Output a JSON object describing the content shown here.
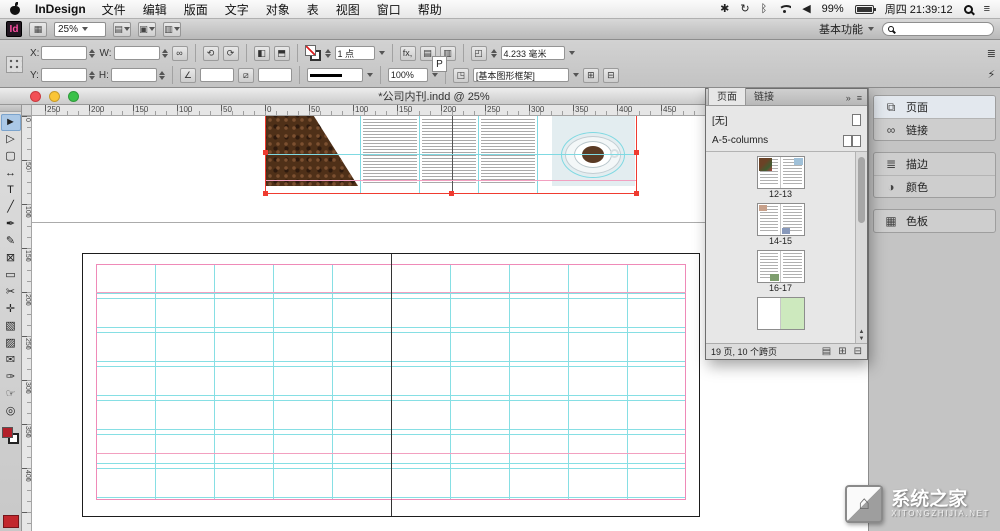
{
  "menu_bar": {
    "app_name": "InDesign",
    "items": [
      "文件",
      "编辑",
      "版面",
      "文字",
      "对象",
      "表",
      "视图",
      "窗口",
      "帮助"
    ],
    "battery": "99%",
    "clock": "周四 21:39:12"
  },
  "app_bar": {
    "logo": "Id",
    "zoom_value": "25%",
    "workspace_label": "基本功能"
  },
  "control_panel": {
    "x_label": "X:",
    "y_label": "Y:",
    "w_label": "W:",
    "h_label": "H:",
    "x_value": "",
    "y_value": "",
    "w_value": "",
    "h_value": "",
    "stroke_weight": "1 点",
    "opacity": "100%",
    "corner_radius": "4.233 毫米",
    "object_style": "[基本图形框架]",
    "p_label": "P",
    "fx_label": "fx,"
  },
  "document": {
    "title": "*公司内刊.indd @ 25%",
    "h_ruler": [
      "250",
      "200",
      "150",
      "100",
      "50",
      "0",
      "50",
      "100",
      "150",
      "200",
      "250",
      "300",
      "350",
      "400",
      "450"
    ],
    "v_ruler": [
      "0",
      "50",
      "100",
      "150",
      "200",
      "250",
      "300",
      "350",
      "400"
    ]
  },
  "tools": {
    "items": [
      {
        "name": "selection-tool",
        "glyph": "►"
      },
      {
        "name": "direct-selection-tool",
        "glyph": "▷"
      },
      {
        "name": "page-tool",
        "glyph": "▢"
      },
      {
        "name": "gap-tool",
        "glyph": "↔"
      },
      {
        "name": "type-tool",
        "glyph": "T"
      },
      {
        "name": "line-tool",
        "glyph": "╱"
      },
      {
        "name": "pen-tool",
        "glyph": "✒"
      },
      {
        "name": "pencil-tool",
        "glyph": "✎"
      },
      {
        "name": "rectangle-frame-tool",
        "glyph": "⊠"
      },
      {
        "name": "rectangle-tool",
        "glyph": "▭"
      },
      {
        "name": "scissors-tool",
        "glyph": "✂"
      },
      {
        "name": "free-transform-tool",
        "glyph": "✛"
      },
      {
        "name": "gradient-swatch-tool",
        "glyph": "▧"
      },
      {
        "name": "gradient-feather-tool",
        "glyph": "▨"
      },
      {
        "name": "note-tool",
        "glyph": "✉"
      },
      {
        "name": "eyedropper-tool",
        "glyph": "✑"
      },
      {
        "name": "hand-tool",
        "glyph": "☞"
      },
      {
        "name": "zoom-tool",
        "glyph": "◎"
      }
    ]
  },
  "pages_panel": {
    "tab_pages": "页面",
    "tab_links": "链接",
    "master_none": "[无]",
    "master_name": "A-5-columns",
    "spreads": [
      {
        "label": "12-13"
      },
      {
        "label": "14-15"
      },
      {
        "label": "16-17"
      },
      {
        "label": ""
      }
    ],
    "status": "19 页, 10 个跨页"
  },
  "dock": {
    "items": [
      {
        "name": "pages",
        "glyph": "⧉",
        "label": "页面"
      },
      {
        "name": "links",
        "glyph": "∞",
        "label": "链接"
      },
      {
        "name": "stroke",
        "glyph": "≣",
        "label": "描边"
      },
      {
        "name": "color",
        "glyph": "◑",
        "label": "颜色"
      },
      {
        "name": "swatches",
        "glyph": "▦",
        "label": "色板"
      }
    ]
  },
  "watermark": {
    "logo_glyph": "⌂",
    "title": "系统之家",
    "subtitle": "XITONGZHIJIA.NET"
  },
  "icons": {
    "spider": "✱",
    "sync": "↻",
    "bluetooth": "ᛒ",
    "volume": "◀",
    "notification": "≡",
    "bridge": "▦",
    "view_opts": "▤",
    "screen_mode": "▣",
    "chain": "∞",
    "rotate_ccw": "⟲",
    "rotate_cw": "⟳",
    "flip_h": "◧",
    "flip_v": "⬒",
    "angle": "∠",
    "shear": "⧄",
    "corner": "◰",
    "grid_a": "▤",
    "grid_b": "▥",
    "style": "◳",
    "lightning": "⚡",
    "menu_lines": "≣",
    "collapse": "»",
    "panel_menu": "≡",
    "page_size": "▤",
    "new_page": "⊞",
    "delete_page": "⊟",
    "scroll_up": "▲",
    "scroll_down": "▼"
  },
  "colors": {
    "guide_cyan": "#86dfe4",
    "guide_pink": "#ef8ab8",
    "selection_red": "#ef3b30",
    "accent_pink": "#ff4fa3"
  }
}
